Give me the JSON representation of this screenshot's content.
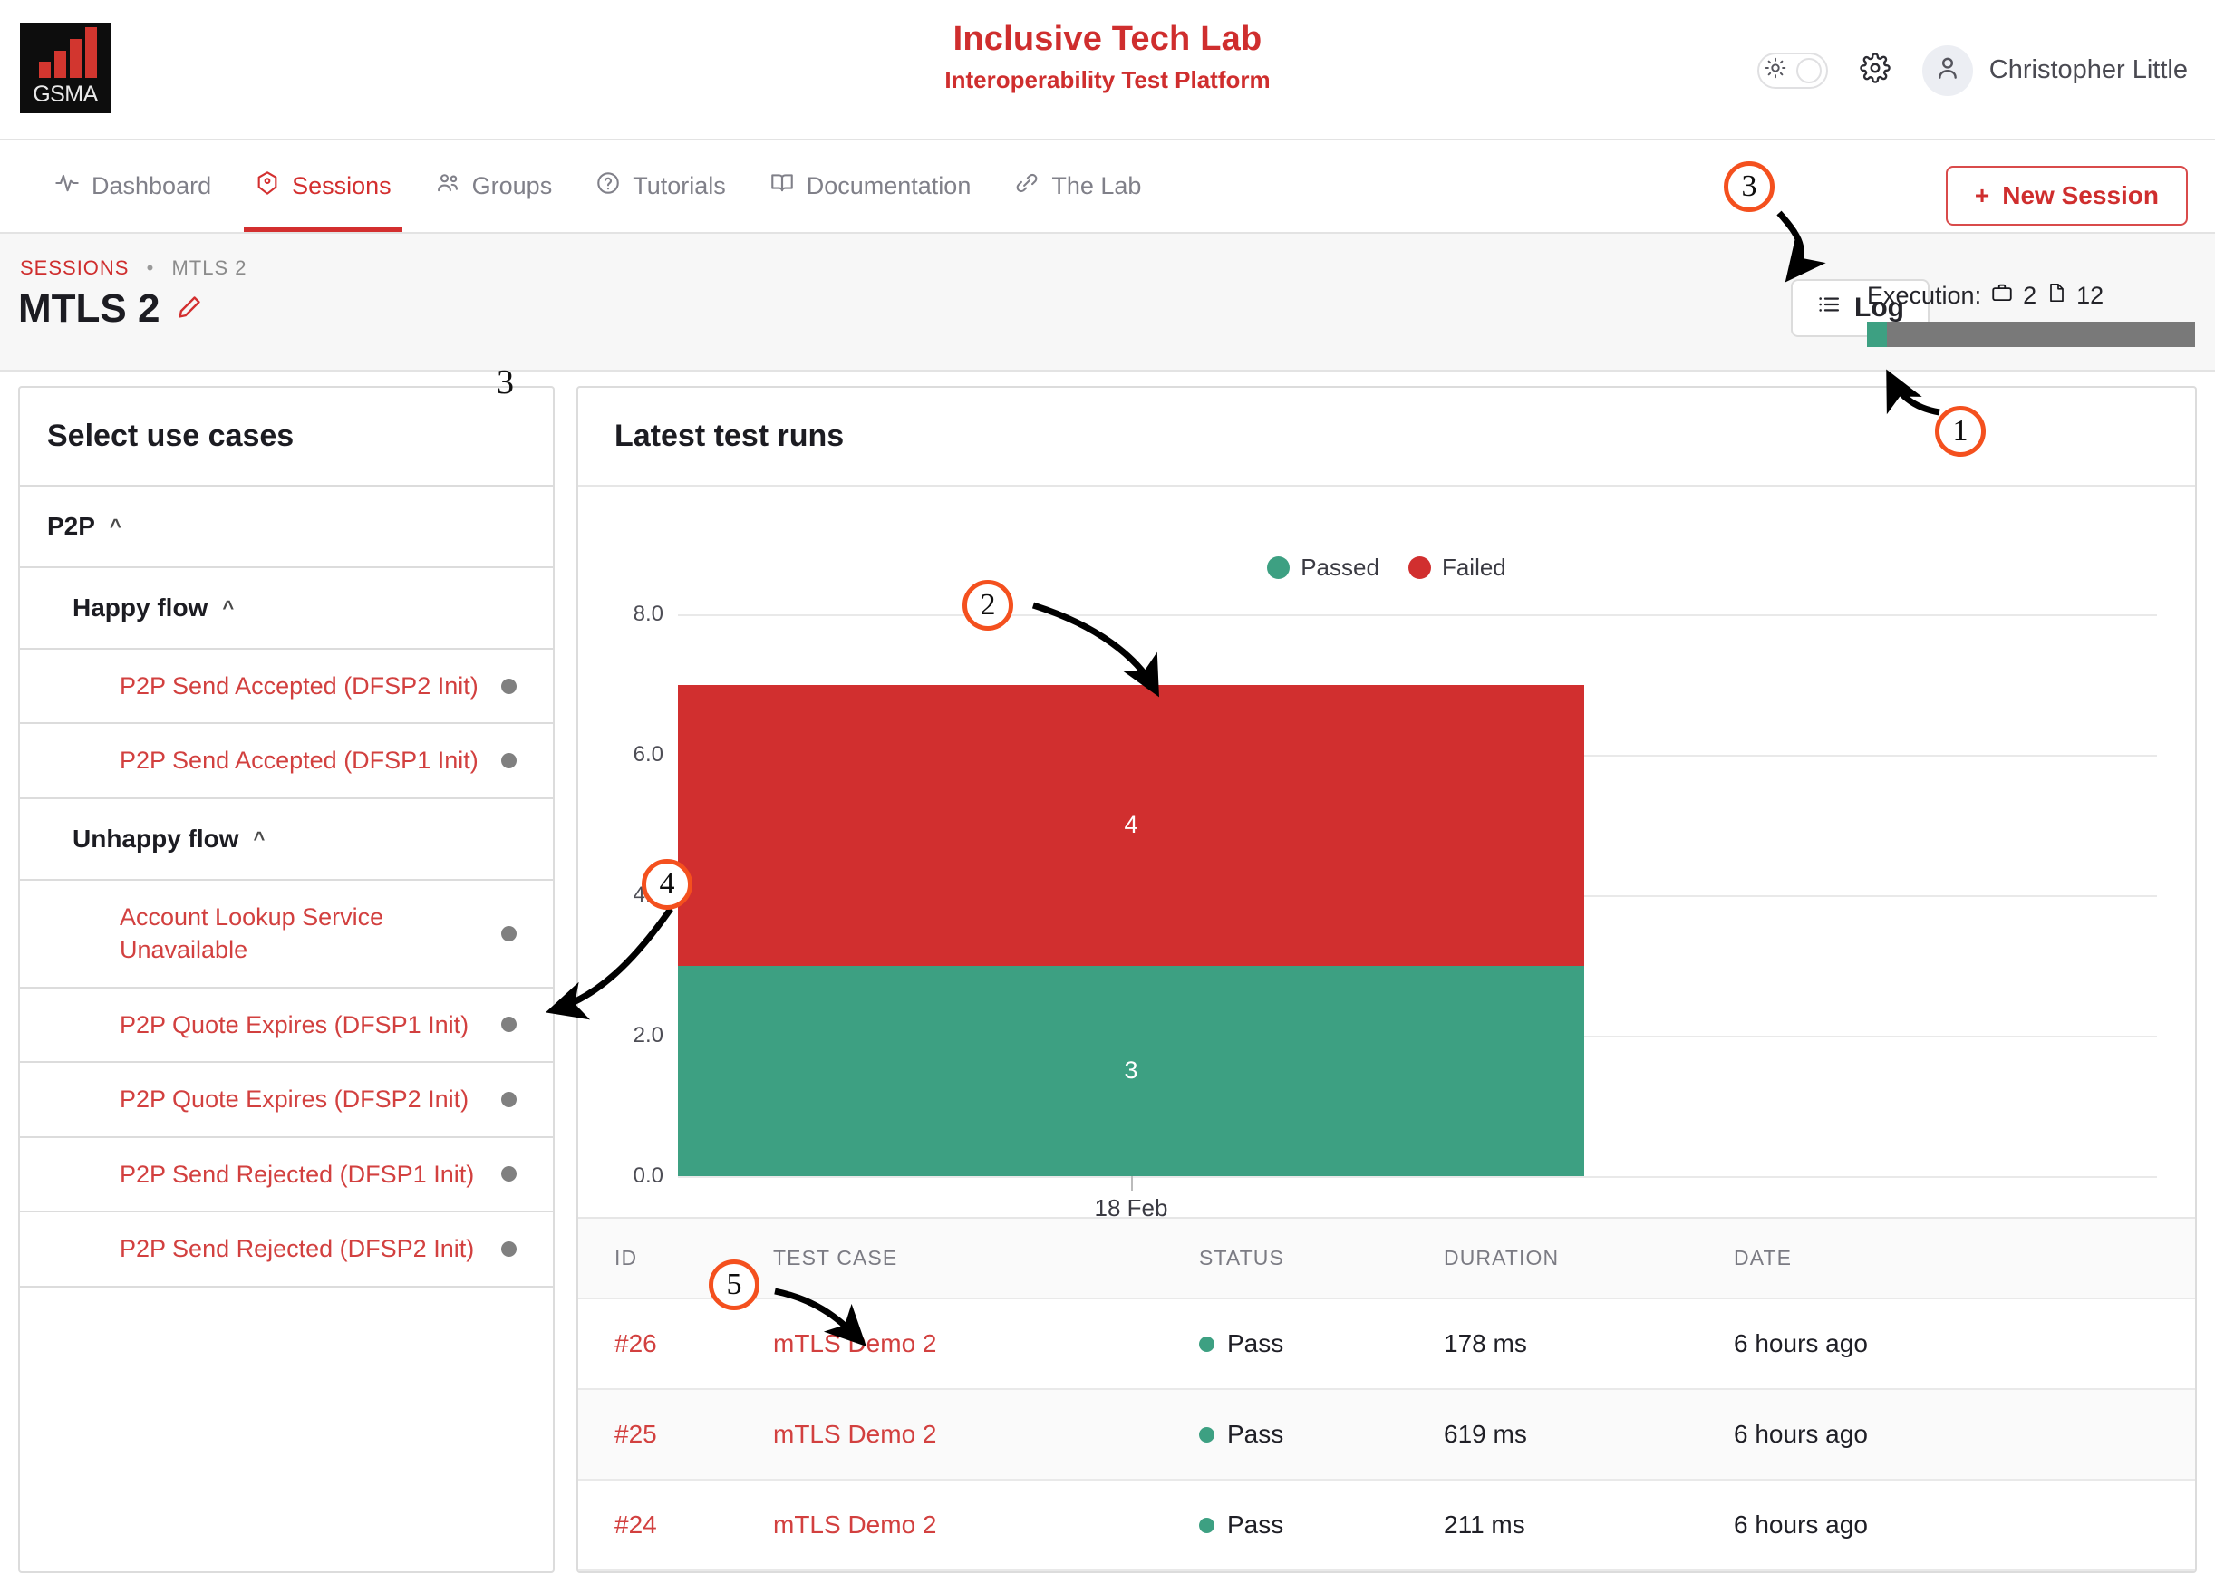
{
  "header": {
    "logo_text": "GSMA",
    "app_title": "Inclusive Tech Lab",
    "app_subtitle": "Interoperability Test Platform",
    "theme_toggle_icon": "sun-icon",
    "settings_icon": "gear-icon",
    "avatar_icon": "user-icon",
    "user_name": "Christopher Little"
  },
  "nav": {
    "items": [
      {
        "label": "Dashboard",
        "icon": "activity-pulse-icon",
        "active": false
      },
      {
        "label": "Sessions",
        "icon": "hexagon-box-icon",
        "active": true
      },
      {
        "label": "Groups",
        "icon": "users-icon",
        "active": false
      },
      {
        "label": "Tutorials",
        "icon": "question-circle-icon",
        "active": false
      },
      {
        "label": "Documentation",
        "icon": "book-icon",
        "active": false
      },
      {
        "label": "The Lab",
        "icon": "link-icon",
        "active": false
      }
    ],
    "new_session_label": "New Session",
    "new_session_plus": "+"
  },
  "subheader": {
    "breadcrumb_root": "SESSIONS",
    "breadcrumb_sep": "•",
    "breadcrumb_current": "MTLS 2",
    "page_title": "MTLS 2",
    "edit_icon": "pencil-icon",
    "log_label": "Log",
    "log_icon": "list-icon",
    "execution_label": "Execution:",
    "execution_suite_icon": "briefcase-icon",
    "execution_suite_count": "2",
    "execution_file_icon": "document-icon",
    "execution_file_count": "12",
    "progress_percent": 6
  },
  "sidebar": {
    "title": "Select use cases",
    "groups": [
      {
        "label": "P2P",
        "level": 0,
        "chevron": "^"
      },
      {
        "label": "Happy flow",
        "level": 1,
        "chevron": "^"
      }
    ],
    "rows": [
      {
        "type": "group",
        "label": "P2P",
        "level": 0,
        "chevron": "^"
      },
      {
        "type": "group",
        "label": "Happy flow",
        "level": 1,
        "chevron": "^"
      },
      {
        "type": "case",
        "label": "P2P Send Accepted (DFSP2 Init)"
      },
      {
        "type": "case",
        "label": "P2P Send Accepted (DFSP1 Init)"
      },
      {
        "type": "group",
        "label": "Unhappy flow",
        "level": 1,
        "chevron": "^"
      },
      {
        "type": "case",
        "label": "Account Lookup Service Unavailable"
      },
      {
        "type": "case",
        "label": "P2P Quote Expires (DFSP1 Init)"
      },
      {
        "type": "case",
        "label": "P2P Quote Expires (DFSP2 Init)"
      },
      {
        "type": "case",
        "label": "P2P Send Rejected (DFSP1 Init)"
      },
      {
        "type": "case",
        "label": "P2P Send Rejected (DFSP2 Init)"
      }
    ]
  },
  "main": {
    "title": "Latest test runs",
    "table": {
      "columns": [
        "ID",
        "TEST CASE",
        "STATUS",
        "DURATION",
        "DATE"
      ],
      "rows": [
        {
          "id": "#26",
          "test_case": "mTLS Demo 2",
          "status": "Pass",
          "duration": "178 ms",
          "date": "6 hours ago"
        },
        {
          "id": "#25",
          "test_case": "mTLS Demo 2",
          "status": "Pass",
          "duration": "619 ms",
          "date": "6 hours ago"
        },
        {
          "id": "#24",
          "test_case": "mTLS Demo 2",
          "status": "Pass",
          "duration": "211 ms",
          "date": "6 hours ago"
        }
      ]
    }
  },
  "chart_data": {
    "type": "bar",
    "stacked": true,
    "title": "Latest test runs",
    "categories": [
      "18 Feb"
    ],
    "series": [
      {
        "name": "Passed",
        "values": [
          3
        ],
        "color": "#3da082"
      },
      {
        "name": "Failed",
        "values": [
          4
        ],
        "color": "#d12f2f"
      }
    ],
    "ylim": [
      0,
      8
    ],
    "yticks": [
      "0.0",
      "2.0",
      "4.0",
      "6.0",
      "8.0"
    ],
    "xlabel": "",
    "ylabel": "",
    "grid": true,
    "legend_position": "top-center",
    "data_labels": [
      "3",
      "4"
    ]
  },
  "annotations": [
    {
      "number": "1"
    },
    {
      "number": "2"
    },
    {
      "number": "3"
    },
    {
      "number": "4"
    },
    {
      "number": "5"
    }
  ],
  "stray_marks": [
    {
      "text": "3"
    }
  ],
  "colors": {
    "brand_red": "#cf2e2e",
    "pass_green": "#3da082",
    "fail_red": "#d12f2f",
    "annotation_orange": "#f4501e",
    "logo_bar_red": "#d2362f"
  }
}
